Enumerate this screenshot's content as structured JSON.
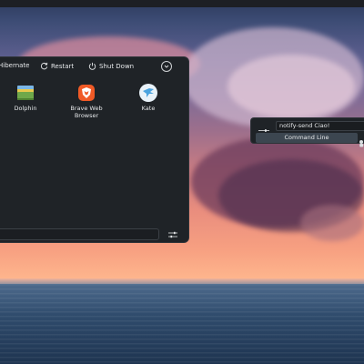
{
  "power_bar": {
    "hibernate_label": "Hibernate",
    "restart_label": "Restart",
    "shutdown_label": "Shut Down",
    "more_icon": "chevron-down-icon"
  },
  "apps": [
    {
      "label": "Dolphin",
      "icon": "dolphin-folder-icon"
    },
    {
      "label": "Brave Web Browser",
      "icon": "brave-lion-icon"
    },
    {
      "label": "Kate",
      "icon": "kate-bird-icon"
    }
  ],
  "search": {
    "value": ""
  },
  "runner": {
    "query": "notify-send Ciao!",
    "result_label": "Command Line"
  },
  "colors": {
    "panel_bg": "#1f2327",
    "text": "#e6e8ea",
    "highlight": "#3c4650",
    "brave_orange": "#f05a26",
    "kate_blue": "#4aa3df"
  }
}
